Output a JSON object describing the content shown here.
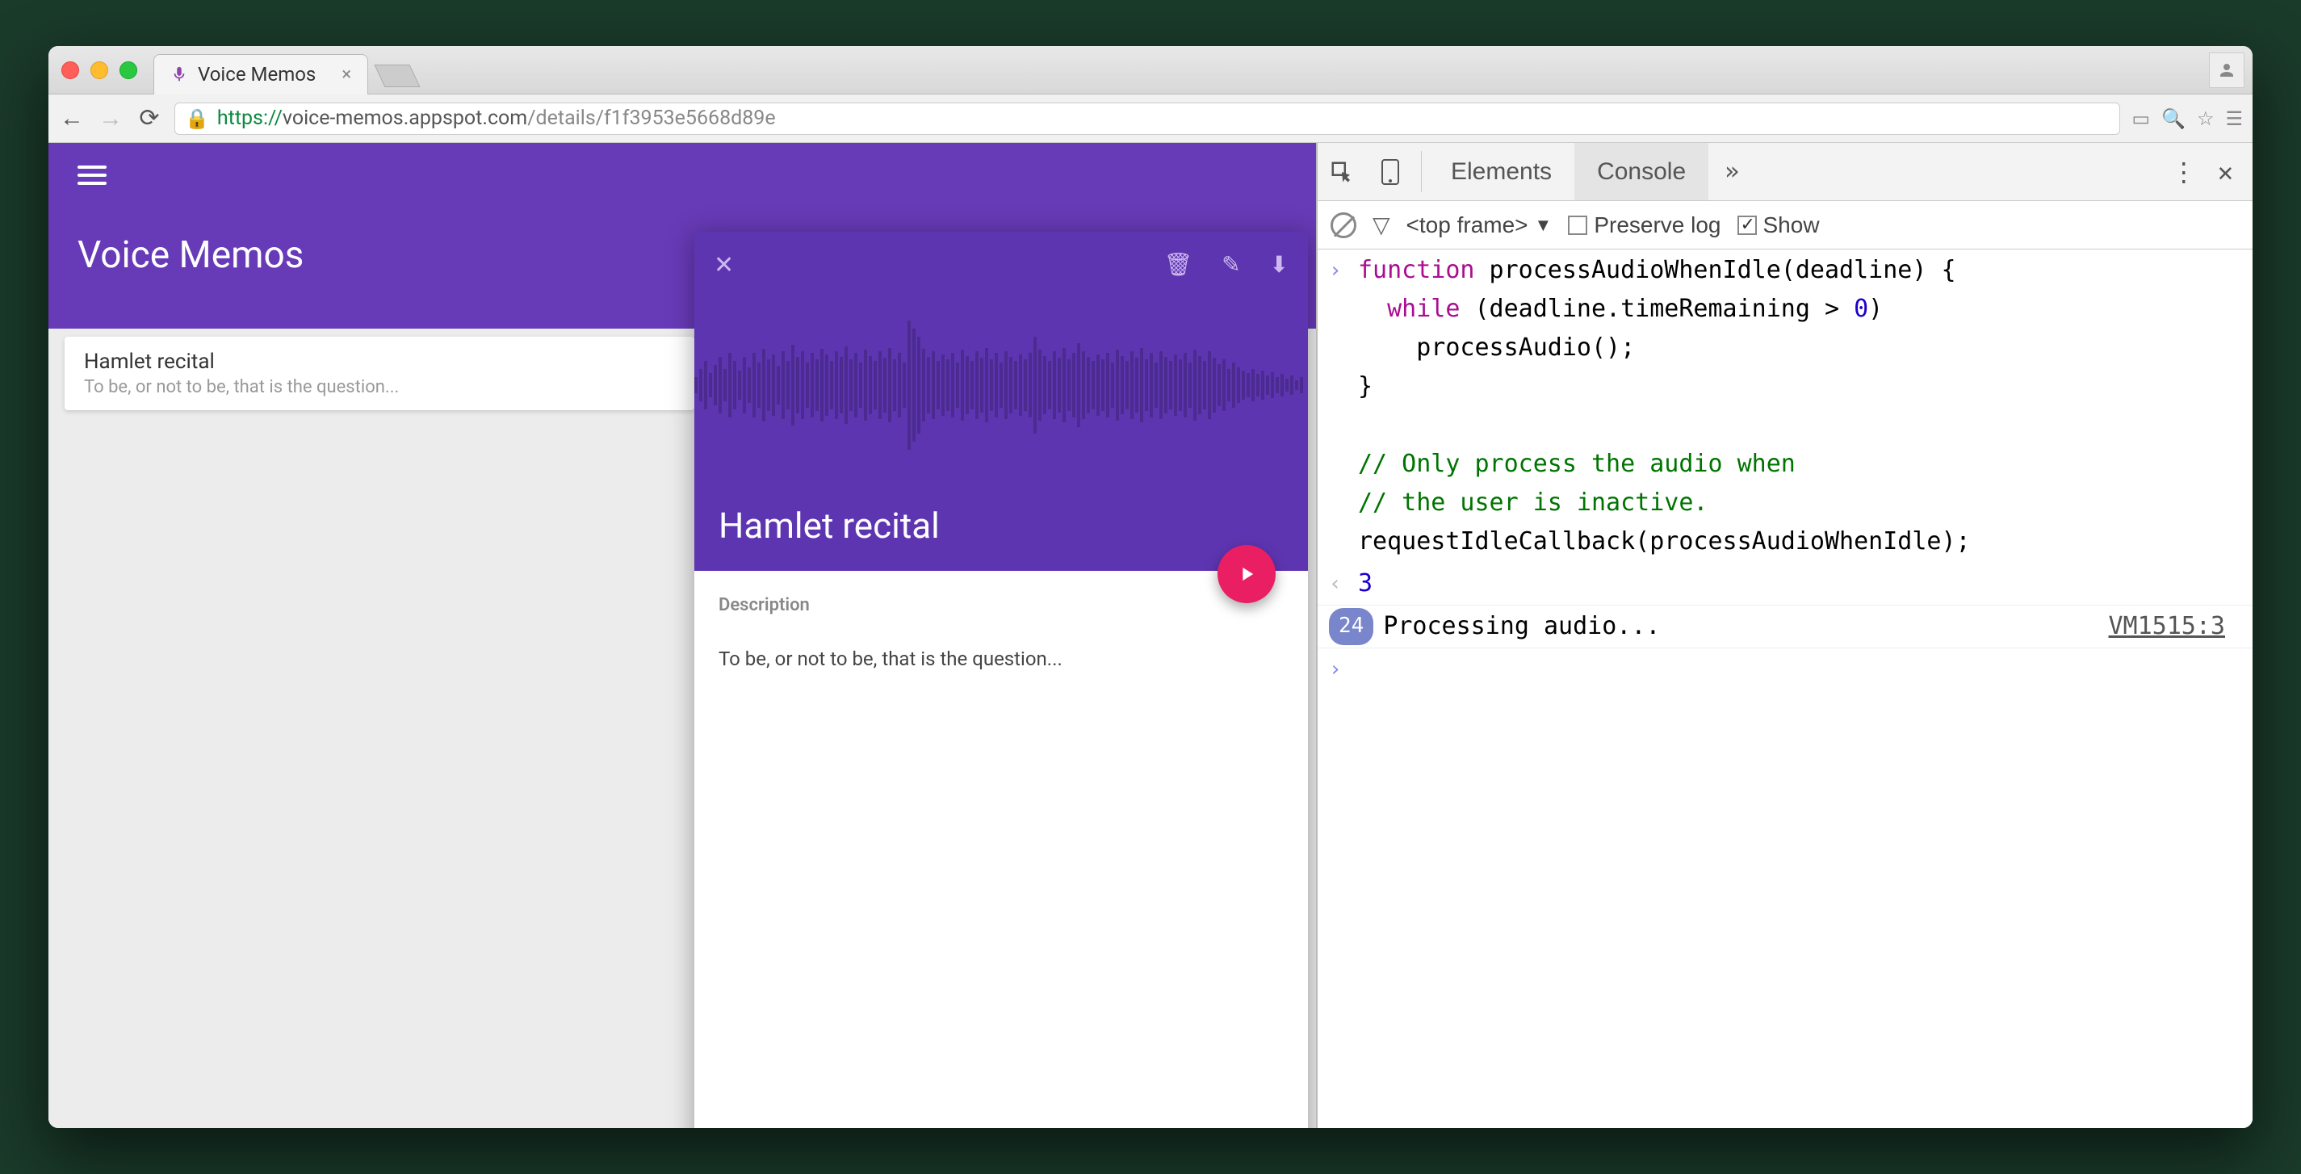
{
  "browser": {
    "tab_title": "Voice Memos",
    "url_scheme": "https://",
    "url_host": "voice-memos.appspot.com",
    "url_path": "/details/f1f3953e5668d89e"
  },
  "app": {
    "title": "Voice Memos",
    "memo": {
      "title": "Hamlet recital",
      "subtitle": "To be, or not to be, that is the question..."
    },
    "detail": {
      "title": "Hamlet recital",
      "desc_label": "Description",
      "desc_text": "To be, or not to be, that is the question..."
    }
  },
  "devtools": {
    "tabs": {
      "elements": "Elements",
      "console": "Console",
      "more": "»"
    },
    "toolbar": {
      "frame": "<top frame>",
      "preserve": "Preserve log",
      "show": "Show"
    },
    "code": {
      "l1a": "function",
      "l1b": " processAudioWhenIdle(deadline) {",
      "l2a": "  while",
      "l2b": " (deadline.timeRemaining > ",
      "l2c": "0",
      "l2d": ")",
      "l3": "    processAudio();",
      "l4": "}",
      "l5": "",
      "l6": "// Only process the audio when",
      "l7": "// the user is inactive.",
      "l8": "requestIdleCallback(processAudioWhenIdle);"
    },
    "return_val": "3",
    "log_count": "24",
    "log_msg": "Processing audio...",
    "log_src": "VM1515:3"
  }
}
